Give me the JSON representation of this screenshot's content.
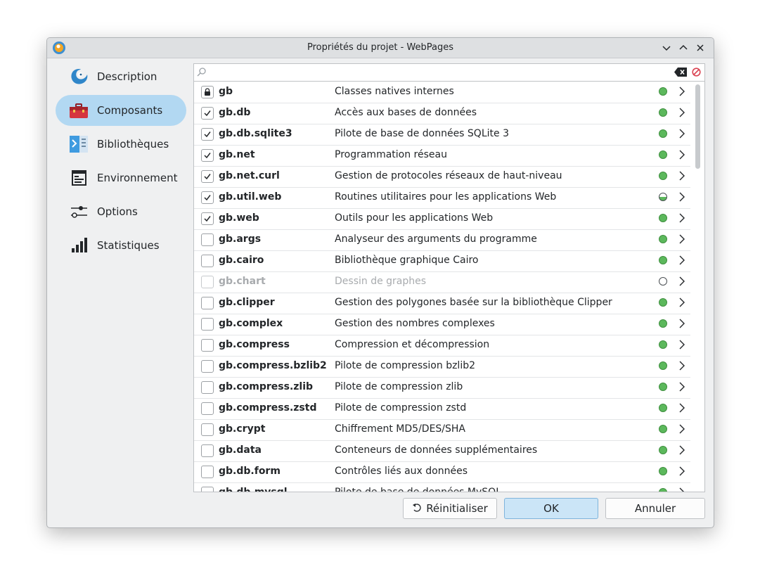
{
  "window": {
    "title": "Propriétés du projet - WebPages"
  },
  "search": {
    "placeholder": ""
  },
  "sidebar": {
    "items": [
      {
        "label": "Description",
        "icon": "gambas-icon"
      },
      {
        "label": "Composants",
        "icon": "toolbox-icon",
        "active": true
      },
      {
        "label": "Bibliothèques",
        "icon": "library-icon"
      },
      {
        "label": "Environnement",
        "icon": "environment-icon"
      },
      {
        "label": "Options",
        "icon": "sliders-icon"
      },
      {
        "label": "Statistiques",
        "icon": "bar-chart-icon"
      }
    ]
  },
  "components": [
    {
      "name": "gb",
      "description": "Classes natives internes",
      "state": "locked",
      "status": "green"
    },
    {
      "name": "gb.db",
      "description": "Accès aux bases de données",
      "state": "checked",
      "status": "green"
    },
    {
      "name": "gb.db.sqlite3",
      "description": "Pilote de base de données SQLite 3",
      "state": "checked",
      "status": "green"
    },
    {
      "name": "gb.net",
      "description": "Programmation réseau",
      "state": "checked",
      "status": "green"
    },
    {
      "name": "gb.net.curl",
      "description": "Gestion de protocoles réseaux de haut-niveau",
      "state": "checked",
      "status": "green"
    },
    {
      "name": "gb.util.web",
      "description": "Routines utilitaires pour les applications Web",
      "state": "checked",
      "status": "partial"
    },
    {
      "name": "gb.web",
      "description": "Outils pour les applications Web",
      "state": "checked",
      "status": "green"
    },
    {
      "name": "gb.args",
      "description": "Analyseur des arguments du programme",
      "state": "unchecked",
      "status": "green"
    },
    {
      "name": "gb.cairo",
      "description": "Bibliothèque graphique Cairo",
      "state": "unchecked",
      "status": "green"
    },
    {
      "name": "gb.chart",
      "description": "Dessin de graphes",
      "state": "disabled",
      "status": "empty"
    },
    {
      "name": "gb.clipper",
      "description": "Gestion des polygones basée sur la bibliothèque Clipper",
      "state": "unchecked",
      "status": "green"
    },
    {
      "name": "gb.complex",
      "description": "Gestion des nombres complexes",
      "state": "unchecked",
      "status": "green"
    },
    {
      "name": "gb.compress",
      "description": "Compression et décompression",
      "state": "unchecked",
      "status": "green"
    },
    {
      "name": "gb.compress.bzlib2",
      "description": "Pilote de compression bzlib2",
      "state": "unchecked",
      "status": "green"
    },
    {
      "name": "gb.compress.zlib",
      "description": "Pilote de compression zlib",
      "state": "unchecked",
      "status": "green"
    },
    {
      "name": "gb.compress.zstd",
      "description": "Pilote de compression zstd",
      "state": "unchecked",
      "status": "green"
    },
    {
      "name": "gb.crypt",
      "description": "Chiffrement MD5/DES/SHA",
      "state": "unchecked",
      "status": "green"
    },
    {
      "name": "gb.data",
      "description": "Conteneurs de données supplémentaires",
      "state": "unchecked",
      "status": "green"
    },
    {
      "name": "gb.db.form",
      "description": "Contrôles liés aux données",
      "state": "unchecked",
      "status": "green"
    },
    {
      "name": "gb.db.mysql",
      "description": "Pilote de base de données MySQL",
      "state": "unchecked",
      "status": "green"
    }
  ],
  "buttons": {
    "reset": "Réinitialiser",
    "ok": "OK",
    "cancel": "Annuler"
  },
  "colors": {
    "accent": "#b2d8f2",
    "status_green": "#5cb85c",
    "primary_button": "#cbe5f7"
  }
}
